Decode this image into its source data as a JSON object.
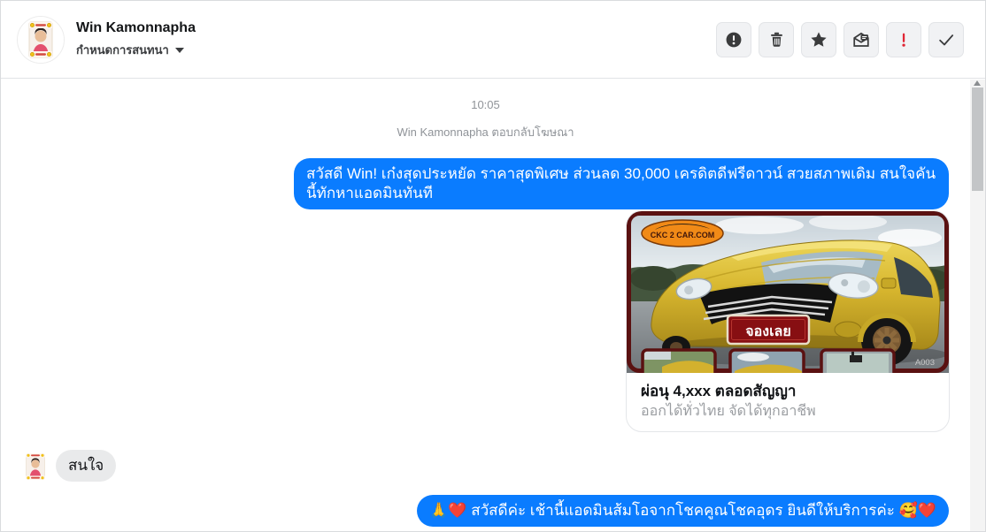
{
  "colors": {
    "bubble_blue": "#0a7cff",
    "bubble_gray": "#e9eaeb",
    "icon_dark": "#3a3b3c",
    "danger_red": "#e02534",
    "meta_gray": "#8f9398"
  },
  "header": {
    "name": "Win Kamonnapha",
    "subtitle": "กำหนดการสนทนา",
    "actions": {
      "report": "exclamation-circle-icon",
      "delete": "trash-icon",
      "star": "star-icon",
      "mark_unread": "envelope-chat-icon",
      "flag_important": "red-exclamation-icon",
      "mark_done": "check-icon"
    }
  },
  "chat": {
    "timestamp": "10:05",
    "context_note": "Win Kamonnapha ตอบกลับโฆษณา",
    "outgoing_message_1": "สวัสดี Win! เก๋งสุดประหยัด ราคาสุดพิเศษ ส่วนลด 30,000 เครดิตดีฟรีดาวน์ สวยสภาพเดิม สนใจคันนี้ทักหาแอดมินทันที",
    "attachment": {
      "dealer_logo": "CKC 2 CAR.COM",
      "plate_sign": "จองเลย",
      "photo_code": "A003",
      "caption_title": "ผ่อนุ 4,xxx ตลอดสัญญา",
      "caption_subtitle": "ออกได้ทั่วไทย จัดได้ทุกอาชีพ"
    },
    "incoming_message": "สนใจ",
    "outgoing_message_2": "🙏❤️ สวัสดีค่ะ เช้านี้แอดมินส้มโอจากโชคคูณโชคอุดร ยินดีให้บริการค่ะ 🥰❤️"
  }
}
